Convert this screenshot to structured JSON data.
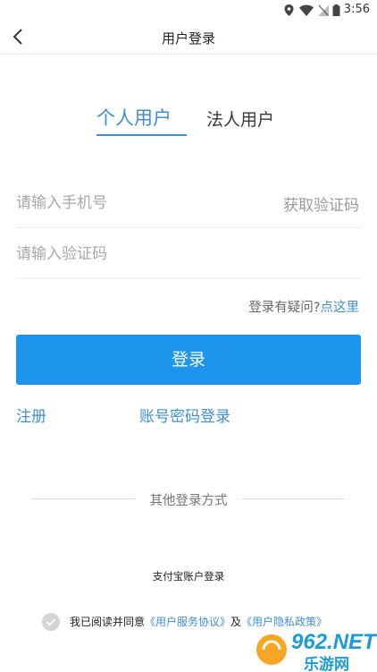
{
  "status_bar": {
    "time": "3:56"
  },
  "nav": {
    "title": "用户登录"
  },
  "tabs": {
    "personal": "个人用户",
    "legal": "法人用户"
  },
  "form": {
    "phone_placeholder": "请输入手机号",
    "get_code": "获取验证码",
    "code_placeholder": "请输入验证码",
    "help_text": "登录有疑问?",
    "help_link": "点这里"
  },
  "login_button": "登录",
  "links": {
    "register": "注册",
    "password_login": "账号密码登录"
  },
  "other": {
    "label": "其他登录方式",
    "alipay": "支付宝账户登录"
  },
  "agreement": {
    "prefix": "我已阅读并同意",
    "service": "《用户服务协议》",
    "and": "及",
    "privacy": "《用户隐私政策》"
  },
  "watermark": {
    "text_top": "962.NET",
    "text_bottom": "乐游网"
  },
  "colors": {
    "accent": "#1e95ec",
    "link": "#3f8fd8"
  }
}
